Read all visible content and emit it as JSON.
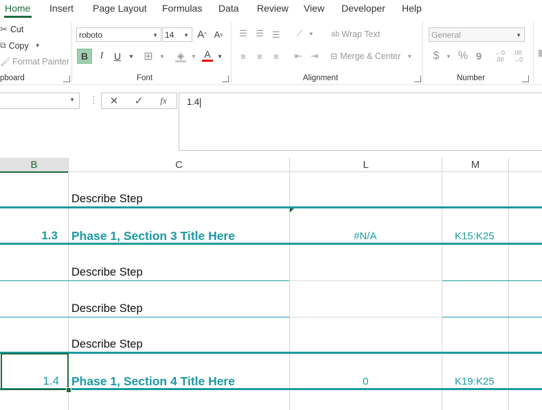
{
  "tabs": [
    "Home",
    "Insert",
    "Page Layout",
    "Formulas",
    "Data",
    "Review",
    "View",
    "Developer",
    "Help"
  ],
  "clipboard": {
    "cut_label": "Cut",
    "copy_label": "Copy",
    "format_painter_label": "Format Painter",
    "group_label": "pboard"
  },
  "font": {
    "family_value": "roboto",
    "size_value": "14",
    "grow_label": "A",
    "shrink_label": "A",
    "bold_label": "B",
    "italic_label": "I",
    "underline_label": "U",
    "font_color_label": "A",
    "group_label": "Font"
  },
  "alignment": {
    "wrap_text_label": "Wrap Text",
    "merge_center_label": "Merge & Center",
    "group_label": "Alignment"
  },
  "number": {
    "format_value": "General",
    "currency_label": "$",
    "percent_label": "%",
    "comma_label": "9",
    "group_label": "Number"
  },
  "formula_bar": {
    "value": "1.4",
    "fx_label": "fx"
  },
  "columns": [
    {
      "id": "B",
      "selected": true
    },
    {
      "id": "C",
      "selected": false
    },
    {
      "id": "L",
      "selected": false
    },
    {
      "id": "M",
      "selected": false
    }
  ],
  "rows": {
    "r1": {
      "c": "Describe Step"
    },
    "r2": {
      "b": "1.3",
      "c": "Phase 1, Section 3 Title Here",
      "l": "#N/A",
      "m": "K15:K25"
    },
    "r3": {
      "c": "Describe Step"
    },
    "r4": {
      "c": "Describe Step"
    },
    "r5": {
      "c": "Describe Step"
    },
    "r6": {
      "b": "1.4",
      "c": "Phase 1, Section 4 Title Here",
      "l": "0",
      "m": "K19:K25"
    }
  },
  "colors": {
    "accent_green": "#1d6b3d",
    "teal": "#1b9aa0",
    "font_color_bar": "#e00000"
  }
}
